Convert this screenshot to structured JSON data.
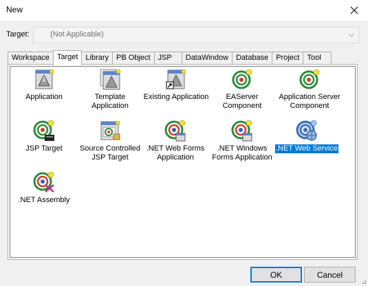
{
  "window": {
    "title": "New",
    "close_icon": "close-icon"
  },
  "target": {
    "label": "Target:",
    "value": "(Not Applicable)"
  },
  "tabs": [
    {
      "label": "Workspace"
    },
    {
      "label": "Target"
    },
    {
      "label": "Library"
    },
    {
      "label": "PB Object"
    },
    {
      "label": "JSP"
    },
    {
      "label": "DataWindow"
    },
    {
      "label": "Database"
    },
    {
      "label": "Project"
    },
    {
      "label": "Tool"
    }
  ],
  "active_tab": "Target",
  "items": [
    {
      "label": "Application",
      "icon": "application-icon"
    },
    {
      "label": "Template\nApplication",
      "icon": "template-application-icon"
    },
    {
      "label": "Existing Application",
      "icon": "existing-application-icon"
    },
    {
      "label": "EAServer\nComponent",
      "icon": "easerver-component-icon"
    },
    {
      "label": "Application Server\nComponent",
      "icon": "application-server-component-icon"
    },
    {
      "label": "JSP Target",
      "icon": "jsp-target-icon"
    },
    {
      "label": "Source Controlled\nJSP Target",
      "icon": "source-controlled-jsp-target-icon"
    },
    {
      "label": ".NET Web Forms\nApplication",
      "icon": "net-web-forms-icon"
    },
    {
      "label": ".NET Windows\nForms Application",
      "icon": "net-windows-forms-icon"
    },
    {
      "label": ".NET Web Service",
      "icon": "net-web-service-icon"
    },
    {
      "label": ".NET Assembly",
      "icon": "net-assembly-icon"
    }
  ],
  "selected_item": ".NET Web Service",
  "buttons": {
    "ok": "OK",
    "cancel": "Cancel"
  },
  "colors": {
    "selection": "#0078d7",
    "target_green": "#2e8b3a",
    "target_red": "#d23b2a"
  }
}
